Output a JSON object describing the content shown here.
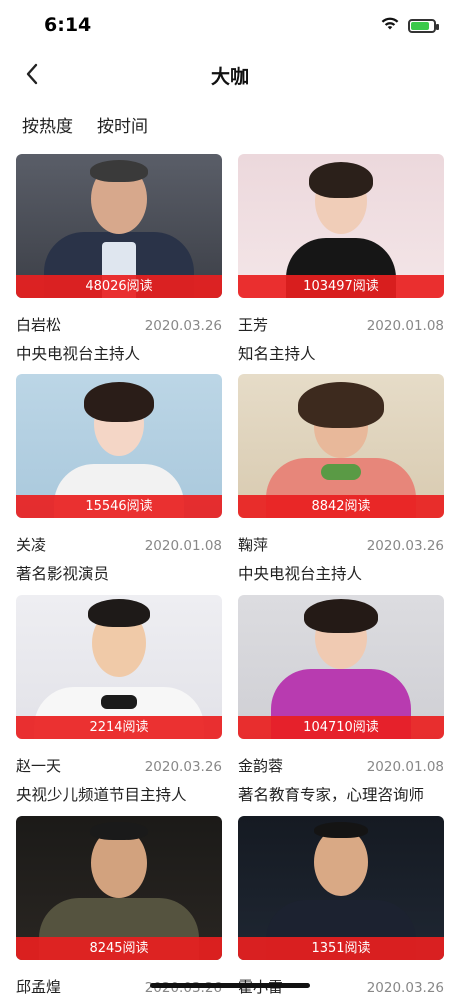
{
  "status": {
    "time": "6:14"
  },
  "nav": {
    "title": "大咖"
  },
  "sort_tabs": [
    {
      "label": "按热度"
    },
    {
      "label": "按时间"
    }
  ],
  "cards": [
    {
      "name": "白岩松",
      "date": "2020.03.26",
      "title": "中央电视台主持人",
      "reads": "48026阅读"
    },
    {
      "name": "王芳",
      "date": "2020.01.08",
      "title": "知名主持人",
      "reads": "103497阅读"
    },
    {
      "name": "关凌",
      "date": "2020.01.08",
      "title": "著名影视演员",
      "reads": "15546阅读"
    },
    {
      "name": "鞠萍",
      "date": "2020.03.26",
      "title": "中央电视台主持人",
      "reads": "8842阅读"
    },
    {
      "name": "赵一天",
      "date": "2020.03.26",
      "title": "央视少儿频道节目主持人",
      "reads": "2214阅读"
    },
    {
      "name": "金韵蓉",
      "date": "2020.01.08",
      "title": "著名教育专家，心理咨询师",
      "reads": "104710阅读"
    },
    {
      "name": "邱孟煌",
      "date": "2020.03.26",
      "title": "",
      "reads": "8245阅读"
    },
    {
      "name": "霍小雷",
      "date": "2020.03.26",
      "title": "",
      "reads": "1351阅读"
    }
  ],
  "colors": {
    "accent": "#e92020",
    "battery": "#3bc94a"
  },
  "icons": {
    "back": "back-chevron-icon",
    "wifi": "wifi-icon",
    "battery": "battery-icon"
  }
}
